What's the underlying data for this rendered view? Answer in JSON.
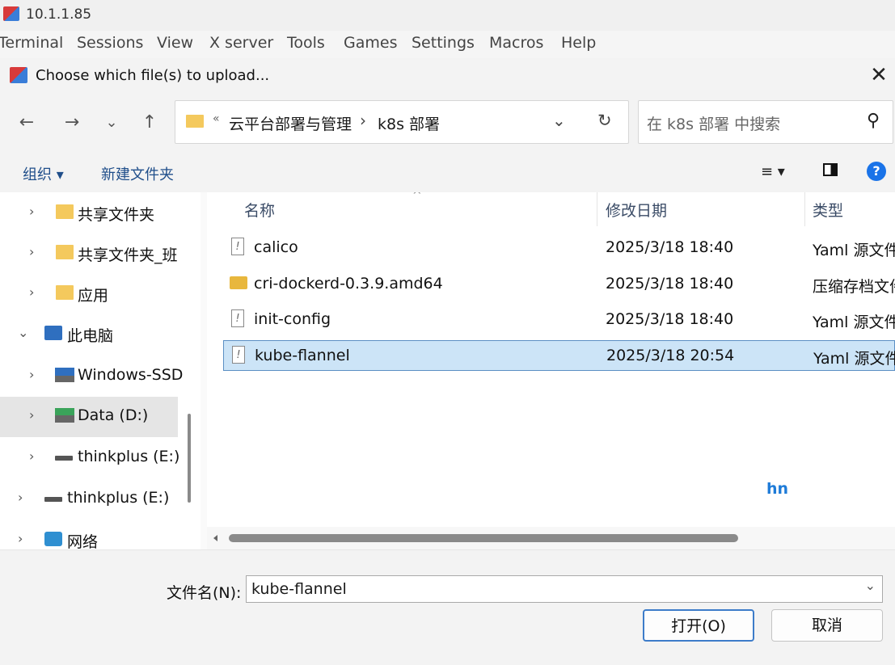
{
  "window": {
    "title": "10.1.1.85"
  },
  "menu": [
    "Terminal",
    "Sessions",
    "View",
    "X server",
    "Tools",
    "Games",
    "Settings",
    "Macros",
    "Help"
  ],
  "dialog": {
    "title": "Choose which file(s) to upload...",
    "close": "✕"
  },
  "nav": {
    "back": "←",
    "forward": "→",
    "recent": "⌄",
    "up": "↑",
    "refresh": "↻",
    "dropdown": "⌄"
  },
  "address": {
    "crumb_sep": "«",
    "part1": "云平台部署与管理",
    "arrow": "›",
    "part2": "k8s 部署"
  },
  "search": {
    "placeholder": "在 k8s 部署 中搜索",
    "icon": "⚲"
  },
  "toolbar": {
    "organize": "组织 ▾",
    "new_folder": "新建文件夹",
    "view_menu": "≡ ▾",
    "help": "?"
  },
  "sidebar": [
    {
      "label": "共享文件夹",
      "chev": "›"
    },
    {
      "label": "共享文件夹_班",
      "chev": "›"
    },
    {
      "label": "应用",
      "chev": "›"
    },
    {
      "label": "此电脑",
      "chev": "⌄"
    },
    {
      "label": "Windows-SSD",
      "chev": "›"
    },
    {
      "label": "Data (D:)",
      "chev": "›"
    },
    {
      "label": "thinkplus (E:)",
      "chev": "›"
    },
    {
      "label": "thinkplus (E:)",
      "chev": "›"
    },
    {
      "label": "网络",
      "chev": "›"
    }
  ],
  "columns": {
    "name": "名称",
    "date": "修改日期",
    "type": "类型",
    "sort": "^"
  },
  "files": [
    {
      "name": "calico",
      "date": "2025/3/18 18:40",
      "type": "Yaml 源文件",
      "icon": "!"
    },
    {
      "name": "cri-dockerd-0.3.9.amd64",
      "date": "2025/3/18 18:40",
      "type": "压缩存档文件",
      "icon": "zip"
    },
    {
      "name": "init-config",
      "date": "2025/3/18 18:40",
      "type": "Yaml 源文件",
      "icon": "!"
    },
    {
      "name": "kube-flannel",
      "date": "2025/3/18 20:54",
      "type": "Yaml 源文件",
      "icon": "!"
    }
  ],
  "watermark": "hn",
  "filename": {
    "label": "文件名(N):",
    "value": "kube-flannel",
    "dropdown": "⌄"
  },
  "buttons": {
    "open": "打开(O)",
    "cancel": "取消"
  },
  "colors": {
    "accent": "#0078d4",
    "selection": "#cce4f7",
    "folder": "#f4c95d"
  }
}
